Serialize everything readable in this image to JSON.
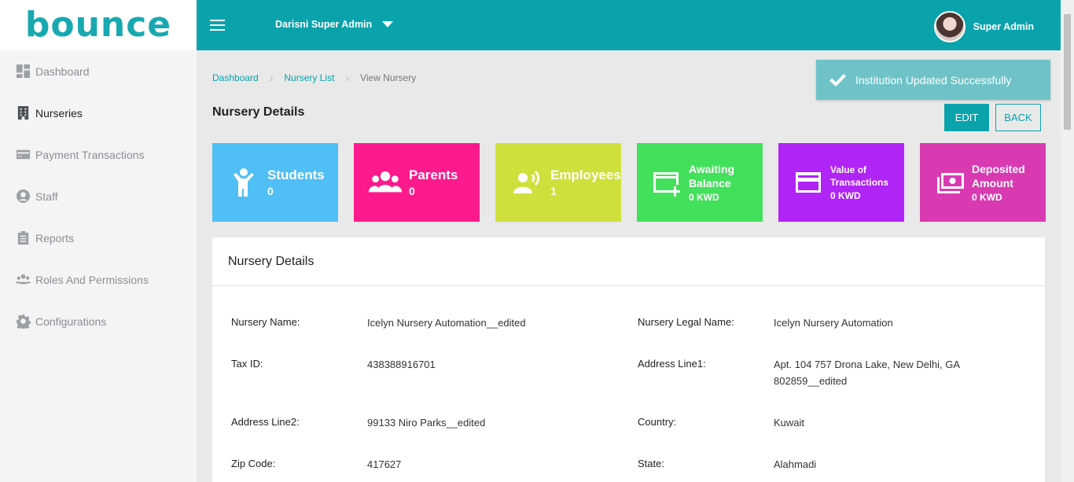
{
  "brand": {
    "logo_text": "bounce"
  },
  "sidebar": {
    "items": [
      {
        "label": "Dashboard",
        "icon": "dashboard-icon"
      },
      {
        "label": "Nurseries",
        "icon": "building-icon"
      },
      {
        "label": "Payment Transactions",
        "icon": "credit-card-icon"
      },
      {
        "label": "Staff",
        "icon": "user-circle-icon"
      },
      {
        "label": "Reports",
        "icon": "clipboard-icon"
      },
      {
        "label": "Roles And Permissions",
        "icon": "users-icon"
      },
      {
        "label": "Configurations",
        "icon": "gear-icon"
      }
    ],
    "active_index": 1
  },
  "topbar": {
    "org_label": "Darisni Super Admin",
    "user_name": "Super Admin"
  },
  "breadcrumb": {
    "items": [
      "Dashboard",
      "Nursery List",
      "View Nursery"
    ]
  },
  "page": {
    "title": "Nursery Details",
    "edit_label": "EDIT",
    "back_label": "BACK"
  },
  "toast": {
    "message": "Institution Updated Successfully"
  },
  "cards": [
    {
      "title": "Students",
      "value": "0",
      "color": "#4fbff5"
    },
    {
      "title": "Parents",
      "value": "0",
      "color": "#fd1a8c"
    },
    {
      "title": "Employees",
      "value": "1",
      "color": "#cfe03d"
    },
    {
      "title": "Awaiting Balance",
      "value": "0 KWD",
      "color": "#43e05b"
    },
    {
      "title": "Value of Transactions",
      "value": "0 KWD",
      "color": "#b024f5"
    },
    {
      "title": "Deposited Amount",
      "value": "0 KWD",
      "color": "#d93ab2"
    }
  ],
  "details": {
    "header": "Nursery Details",
    "fields": {
      "nursery_name": {
        "label": "Nursery Name:",
        "value": "Icelyn Nursery Automation__edited"
      },
      "legal_name": {
        "label": "Nursery Legal Name:",
        "value": "Icelyn Nursery Automation"
      },
      "tax_id": {
        "label": "Tax ID:",
        "value": "438388916701"
      },
      "address1": {
        "label": "Address Line1:",
        "value_line1": "Apt. 104 757 Drona Lake, New Delhi, GA",
        "value_line2": "802859__edited"
      },
      "address2": {
        "label": "Address Line2:",
        "value": "99133 Niro Parks__edited"
      },
      "country": {
        "label": "Country:",
        "value": "Kuwait"
      },
      "zip": {
        "label": "Zip Code:",
        "value": "417627"
      },
      "state": {
        "label": "State:",
        "value": "Alahmadi"
      }
    }
  }
}
